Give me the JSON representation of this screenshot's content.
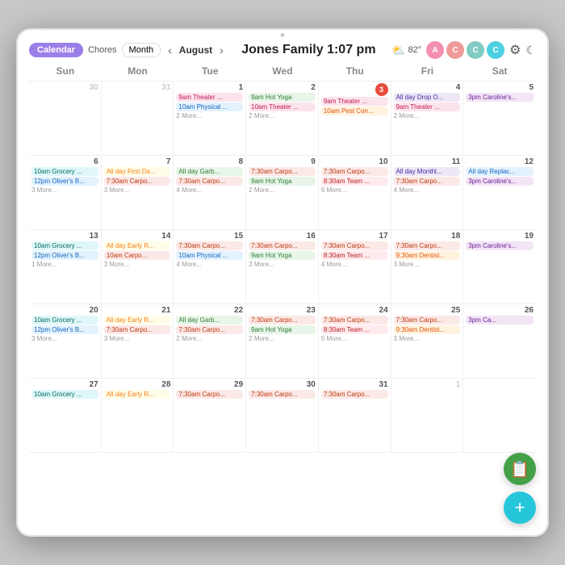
{
  "device": {
    "title": "Jones Family Calendar"
  },
  "header": {
    "calendar_btn": "Calendar",
    "chores_btn": "Chores",
    "month_btn": "Month",
    "nav_prev": "‹",
    "nav_next": "›",
    "month": "August",
    "family_name": "Jones Family",
    "time": "1:07 pm",
    "weather_icon": "⛅",
    "temp": "82°",
    "avatars": [
      {
        "letter": "A",
        "color": "#f48fb1"
      },
      {
        "letter": "C",
        "color": "#ef9a9a"
      },
      {
        "letter": "C",
        "color": "#80cbc4"
      },
      {
        "letter": "C",
        "color": "#4dd0e1"
      }
    ],
    "gear_icon": "⚙",
    "moon_icon": "☾"
  },
  "calendar": {
    "day_headers": [
      "Sun",
      "Mon",
      "Tue",
      "Wed",
      "Thu",
      "Fri",
      "Sat"
    ],
    "weeks": [
      {
        "days": [
          {
            "date": "30",
            "other": true,
            "events": []
          },
          {
            "date": "31",
            "other": true,
            "events": []
          },
          {
            "date": "1",
            "events": [
              {
                "label": "9am Theater ...",
                "class": "ev-pink"
              },
              {
                "label": "10am Physical ...",
                "class": "ev-blue"
              },
              {
                "label": "2 More...",
                "class": "more"
              }
            ]
          },
          {
            "date": "2",
            "events": [
              {
                "label": "9am Hot Yoga",
                "class": "ev-green"
              },
              {
                "label": "10am Theater ...",
                "class": "ev-pink"
              },
              {
                "label": "2 More...",
                "class": "more"
              }
            ]
          },
          {
            "date": "3",
            "today": true,
            "events": [
              {
                "label": "9am Theater ...",
                "class": "ev-pink"
              },
              {
                "label": "10am Pest Con...",
                "class": "ev-orange"
              }
            ]
          },
          {
            "date": "4",
            "events": [
              {
                "label": "All day Drop O...",
                "class": "ev-lavender"
              },
              {
                "label": "9am Theater ...",
                "class": "ev-pink"
              },
              {
                "label": "2 More...",
                "class": "more"
              }
            ]
          },
          {
            "date": "5",
            "events": [
              {
                "label": "3pm Caroline's...",
                "class": "ev-purple"
              }
            ]
          }
        ]
      },
      {
        "days": [
          {
            "date": "6",
            "events": [
              {
                "label": "10am Grocery ...",
                "class": "ev-teal"
              },
              {
                "label": "12pm Oliver's B...",
                "class": "ev-blue"
              },
              {
                "label": "3 More...",
                "class": "more"
              }
            ]
          },
          {
            "date": "7",
            "events": [
              {
                "label": "All day First Da...",
                "class": "ev-yellow"
              },
              {
                "label": "7:30am Carpo...",
                "class": "ev-peach"
              },
              {
                "label": "3 More...",
                "class": "more"
              }
            ]
          },
          {
            "date": "8",
            "events": [
              {
                "label": "All day Garb...",
                "class": "ev-green"
              },
              {
                "label": "7:30am Carpo...",
                "class": "ev-peach"
              },
              {
                "label": "4 More...",
                "class": "more"
              }
            ]
          },
          {
            "date": "9",
            "events": [
              {
                "label": "7:30am Carpo...",
                "class": "ev-peach"
              },
              {
                "label": "9am Hot Yoga",
                "class": "ev-green"
              },
              {
                "label": "2 More...",
                "class": "more"
              }
            ]
          },
          {
            "date": "10",
            "events": [
              {
                "label": "7:30am Carpo...",
                "class": "ev-peach"
              },
              {
                "label": "8:30am Team ...",
                "class": "ev-red"
              },
              {
                "label": "6 More...",
                "class": "more"
              }
            ]
          },
          {
            "date": "11",
            "events": [
              {
                "label": "All day Monthl...",
                "class": "ev-lavender"
              },
              {
                "label": "7:30am Carpo...",
                "class": "ev-peach"
              },
              {
                "label": "4 More...",
                "class": "more"
              }
            ]
          },
          {
            "date": "12",
            "events": [
              {
                "label": "All day Replac...",
                "class": "ev-blue"
              },
              {
                "label": "3pm Caroline's...",
                "class": "ev-purple"
              }
            ]
          }
        ]
      },
      {
        "days": [
          {
            "date": "13",
            "events": [
              {
                "label": "10am Grocery ...",
                "class": "ev-teal"
              },
              {
                "label": "12pm Oliver's B...",
                "class": "ev-blue"
              },
              {
                "label": "1 More...",
                "class": "more"
              }
            ]
          },
          {
            "date": "14",
            "events": [
              {
                "label": "All day Early R...",
                "class": "ev-yellow"
              },
              {
                "label": "10am Carpo...",
                "class": "ev-peach"
              },
              {
                "label": "3 More...",
                "class": "more"
              }
            ]
          },
          {
            "date": "15",
            "events": [
              {
                "label": "7:30am Carpo...",
                "class": "ev-peach"
              },
              {
                "label": "10am Physical ...",
                "class": "ev-blue"
              },
              {
                "label": "4 More...",
                "class": "more"
              }
            ]
          },
          {
            "date": "16",
            "events": [
              {
                "label": "7:30am Carpo...",
                "class": "ev-peach"
              },
              {
                "label": "9am Hot Yoga",
                "class": "ev-green"
              },
              {
                "label": "3 More...",
                "class": "more"
              }
            ]
          },
          {
            "date": "17",
            "events": [
              {
                "label": "7:30am Carpo...",
                "class": "ev-peach"
              },
              {
                "label": "8:30am Team ...",
                "class": "ev-red"
              },
              {
                "label": "4 More...",
                "class": "more"
              }
            ]
          },
          {
            "date": "18",
            "events": [
              {
                "label": "7:30am Carpo...",
                "class": "ev-peach"
              },
              {
                "label": "9:30am Dentist...",
                "class": "ev-orange"
              },
              {
                "label": "3 More...",
                "class": "more"
              }
            ]
          },
          {
            "date": "19",
            "events": [
              {
                "label": "3pm Caroline's...",
                "class": "ev-purple"
              }
            ]
          }
        ]
      },
      {
        "days": [
          {
            "date": "20",
            "events": [
              {
                "label": "10am Grocery ...",
                "class": "ev-teal"
              },
              {
                "label": "12pm Oliver's B...",
                "class": "ev-blue"
              },
              {
                "label": "3 More...",
                "class": "more"
              }
            ]
          },
          {
            "date": "21",
            "events": [
              {
                "label": "All day Early R...",
                "class": "ev-yellow"
              },
              {
                "label": "7:30am Carpo...",
                "class": "ev-peach"
              },
              {
                "label": "3 More...",
                "class": "more"
              }
            ]
          },
          {
            "date": "22",
            "events": [
              {
                "label": "All day Garb...",
                "class": "ev-green"
              },
              {
                "label": "7:30am Carpo...",
                "class": "ev-peach"
              },
              {
                "label": "2 More...",
                "class": "more"
              }
            ]
          },
          {
            "date": "23",
            "events": [
              {
                "label": "7:30am Carpo...",
                "class": "ev-peach"
              },
              {
                "label": "9am Hot Yoga",
                "class": "ev-green"
              },
              {
                "label": "2 More...",
                "class": "more"
              }
            ]
          },
          {
            "date": "24",
            "events": [
              {
                "label": "7:30am Carpo...",
                "class": "ev-peach"
              },
              {
                "label": "8:30am Team ...",
                "class": "ev-red"
              },
              {
                "label": "5 More...",
                "class": "more"
              }
            ]
          },
          {
            "date": "25",
            "events": [
              {
                "label": "7:30am Carpo...",
                "class": "ev-peach"
              },
              {
                "label": "9:30am Dentist...",
                "class": "ev-orange"
              },
              {
                "label": "3 More...",
                "class": "more"
              }
            ]
          },
          {
            "date": "26",
            "events": [
              {
                "label": "3pm Ca...",
                "class": "ev-purple"
              }
            ]
          }
        ]
      },
      {
        "days": [
          {
            "date": "27",
            "events": [
              {
                "label": "10am Grocery ...",
                "class": "ev-teal"
              }
            ]
          },
          {
            "date": "28",
            "events": [
              {
                "label": "All day Early R...",
                "class": "ev-yellow"
              }
            ]
          },
          {
            "date": "29",
            "events": [
              {
                "label": "7:30am Carpo...",
                "class": "ev-peach"
              }
            ]
          },
          {
            "date": "30",
            "events": [
              {
                "label": "7:30am Carpo...",
                "class": "ev-peach"
              }
            ]
          },
          {
            "date": "31",
            "events": [
              {
                "label": "7:30am Carpo...",
                "class": "ev-peach"
              }
            ]
          },
          {
            "date": "1",
            "other": true,
            "events": []
          },
          {
            "date": "",
            "other": true,
            "events": []
          }
        ]
      }
    ]
  },
  "fabs": {
    "doc_icon": "📋",
    "plus_icon": "+"
  }
}
